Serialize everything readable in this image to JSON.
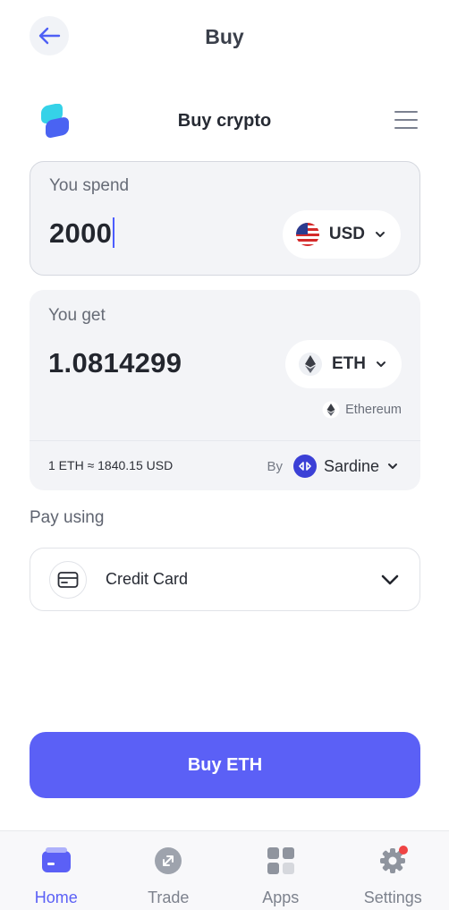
{
  "header": {
    "title": "Buy"
  },
  "widget": {
    "title": "Buy crypto"
  },
  "spend": {
    "label": "You spend",
    "amount": "2000",
    "currency": "USD"
  },
  "get": {
    "label": "You get",
    "amount": "1.0814299",
    "currency": "ETH",
    "network": "Ethereum",
    "rate": "1 ETH ≈ 1840.15 USD",
    "provider_by": "By",
    "provider_name": "Sardine"
  },
  "payment": {
    "label": "Pay using",
    "method": "Credit Card"
  },
  "cta": {
    "label": "Buy ETH"
  },
  "nav": {
    "items": [
      {
        "label": "Home",
        "icon": "wallet-icon",
        "active": true
      },
      {
        "label": "Trade",
        "icon": "trade-icon",
        "active": false
      },
      {
        "label": "Apps",
        "icon": "apps-grid-icon",
        "active": false
      },
      {
        "label": "Settings",
        "icon": "gear-icon",
        "active": false
      }
    ]
  },
  "colors": {
    "accent": "#5b60f6",
    "card_bg": "#f3f4f7",
    "badge": "#ef4444"
  }
}
